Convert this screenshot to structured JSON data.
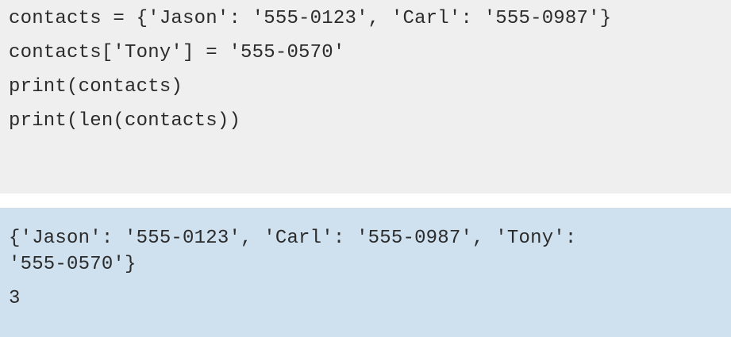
{
  "code": {
    "lines": [
      "contacts = {'Jason': '555-0123', 'Carl': '555-0987'}",
      "contacts['Tony'] = '555-0570'",
      "print(contacts)",
      "print(len(contacts))"
    ]
  },
  "output": {
    "lines": [
      "{'Jason': '555-0123', 'Carl': '555-0987', 'Tony':",
      "'555-0570'}",
      "3"
    ]
  },
  "colors": {
    "code_background": "#efefef",
    "output_background": "#cfe0ee",
    "text": "#2b2b2b"
  }
}
